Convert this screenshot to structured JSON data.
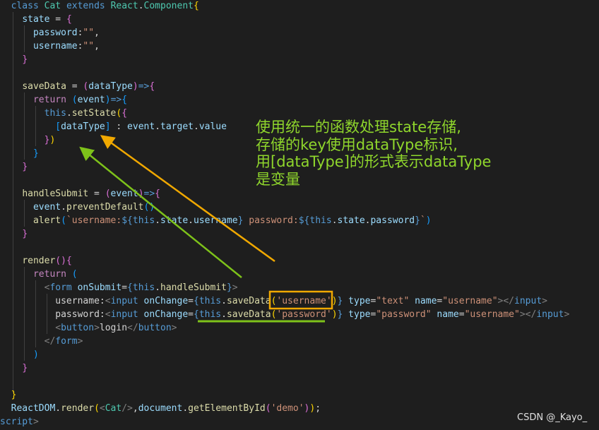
{
  "code_lines": [
    [
      [
        "  ",
        "pl"
      ],
      [
        "class ",
        "kw"
      ],
      [
        "Cat ",
        "cls"
      ],
      [
        "extends ",
        "kw"
      ],
      [
        "React",
        "cls"
      ],
      [
        ".",
        "pl"
      ],
      [
        "Component",
        "cls"
      ],
      [
        "{",
        "br1"
      ]
    ],
    [
      [
        "    ",
        "pl"
      ],
      [
        "state",
        "var"
      ],
      [
        " = ",
        "pl"
      ],
      [
        "{",
        "br2"
      ]
    ],
    [
      [
        "      ",
        "pl"
      ],
      [
        "password",
        "var"
      ],
      [
        ":",
        "pl"
      ],
      [
        "\"\"",
        "str"
      ],
      [
        ",",
        "pl"
      ]
    ],
    [
      [
        "      ",
        "pl"
      ],
      [
        "username",
        "var"
      ],
      [
        ":",
        "pl"
      ],
      [
        "\"\"",
        "str"
      ],
      [
        ",",
        "pl"
      ]
    ],
    [
      [
        "    ",
        "pl"
      ],
      [
        "}",
        "br2"
      ]
    ],
    [
      [
        "",
        "pl"
      ]
    ],
    [
      [
        "    ",
        "pl"
      ],
      [
        "saveData",
        "fn"
      ],
      [
        " = ",
        "pl"
      ],
      [
        "(",
        "br2"
      ],
      [
        "dataType",
        "var"
      ],
      [
        ")",
        "br2"
      ],
      [
        "=>",
        "kw"
      ],
      [
        "{",
        "br2"
      ]
    ],
    [
      [
        "      ",
        "pl"
      ],
      [
        "return ",
        "ctl"
      ],
      [
        "(",
        "br3"
      ],
      [
        "event",
        "var"
      ],
      [
        ")",
        "br3"
      ],
      [
        "=>",
        "kw"
      ],
      [
        "{",
        "br3"
      ]
    ],
    [
      [
        "        ",
        "pl"
      ],
      [
        "this",
        "kw"
      ],
      [
        ".",
        "pl"
      ],
      [
        "setState",
        "fn"
      ],
      [
        "(",
        "br1"
      ],
      [
        "{",
        "br2"
      ]
    ],
    [
      [
        "          ",
        "pl"
      ],
      [
        "[",
        "br3"
      ],
      [
        "dataType",
        "var"
      ],
      [
        "]",
        "br3"
      ],
      [
        " : ",
        "pl"
      ],
      [
        "event",
        "var"
      ],
      [
        ".",
        "pl"
      ],
      [
        "target",
        "var"
      ],
      [
        ".",
        "pl"
      ],
      [
        "value",
        "var"
      ]
    ],
    [
      [
        "        ",
        "pl"
      ],
      [
        "}",
        "br2"
      ],
      [
        ")",
        "br1"
      ]
    ],
    [
      [
        "      ",
        "pl"
      ],
      [
        "}",
        "br3"
      ]
    ],
    [
      [
        "    ",
        "pl"
      ],
      [
        "}",
        "br2"
      ]
    ],
    [
      [
        "",
        "pl"
      ]
    ],
    [
      [
        "    ",
        "pl"
      ],
      [
        "handleSubmit",
        "fn"
      ],
      [
        " = ",
        "pl"
      ],
      [
        "(",
        "br2"
      ],
      [
        "event",
        "var"
      ],
      [
        ")",
        "br2"
      ],
      [
        "=>",
        "kw"
      ],
      [
        "{",
        "br2"
      ]
    ],
    [
      [
        "      ",
        "pl"
      ],
      [
        "event",
        "var"
      ],
      [
        ".",
        "pl"
      ],
      [
        "preventDefault",
        "fn"
      ],
      [
        "()",
        "br3"
      ]
    ],
    [
      [
        "      ",
        "pl"
      ],
      [
        "alert",
        "fn"
      ],
      [
        "(",
        "br3"
      ],
      [
        "`username:",
        "str"
      ],
      [
        "${",
        "kw"
      ],
      [
        "this",
        "kw"
      ],
      [
        ".",
        "pl"
      ],
      [
        "state",
        "var"
      ],
      [
        ".",
        "pl"
      ],
      [
        "username",
        "var"
      ],
      [
        "}",
        "kw"
      ],
      [
        " password:",
        "str"
      ],
      [
        "${",
        "kw"
      ],
      [
        "this",
        "kw"
      ],
      [
        ".",
        "pl"
      ],
      [
        "state",
        "var"
      ],
      [
        ".",
        "pl"
      ],
      [
        "password",
        "var"
      ],
      [
        "}",
        "kw"
      ],
      [
        "`",
        "str"
      ],
      [
        ")",
        "br3"
      ]
    ],
    [
      [
        "    ",
        "pl"
      ],
      [
        "}",
        "br2"
      ]
    ],
    [
      [
        "",
        "pl"
      ]
    ],
    [
      [
        "    ",
        "pl"
      ],
      [
        "render",
        "fn"
      ],
      [
        "(",
        "br2"
      ],
      [
        ")",
        "br2"
      ],
      [
        "{",
        "br2"
      ]
    ],
    [
      [
        "      ",
        "pl"
      ],
      [
        "return ",
        "ctl"
      ],
      [
        "(",
        "br3"
      ]
    ],
    [
      [
        "        ",
        "pl"
      ],
      [
        "<",
        "ang"
      ],
      [
        "form ",
        "tag"
      ],
      [
        "onSubmit",
        "var"
      ],
      [
        "=",
        "pl"
      ],
      [
        "{",
        "kw"
      ],
      [
        "this",
        "kw"
      ],
      [
        ".",
        "pl"
      ],
      [
        "handleSubmit",
        "fn"
      ],
      [
        "}",
        "kw"
      ],
      [
        ">",
        "ang"
      ]
    ],
    [
      [
        "          ",
        "pl"
      ],
      [
        "username:",
        "pl"
      ],
      [
        "<",
        "ang"
      ],
      [
        "input ",
        "tag"
      ],
      [
        "onChange",
        "var"
      ],
      [
        "=",
        "pl"
      ],
      [
        "{",
        "kw"
      ],
      [
        "this",
        "kw"
      ],
      [
        ".",
        "pl"
      ],
      [
        "saveData",
        "fn"
      ],
      [
        "(",
        "br1"
      ],
      [
        "'username'",
        "str"
      ],
      [
        ")",
        "br1"
      ],
      [
        "}",
        "kw"
      ],
      [
        " type",
        "var"
      ],
      [
        "=",
        "pl"
      ],
      [
        "\"text\"",
        "str"
      ],
      [
        " name",
        "var"
      ],
      [
        "=",
        "pl"
      ],
      [
        "\"username\"",
        "str"
      ],
      [
        "></",
        "ang"
      ],
      [
        "input",
        "tag"
      ],
      [
        ">",
        "ang"
      ]
    ],
    [
      [
        "          ",
        "pl"
      ],
      [
        "password:",
        "pl"
      ],
      [
        "<",
        "ang"
      ],
      [
        "input ",
        "tag"
      ],
      [
        "onChange",
        "var"
      ],
      [
        "=",
        "pl"
      ],
      [
        "{",
        "kw"
      ],
      [
        "this",
        "kw"
      ],
      [
        ".",
        "pl"
      ],
      [
        "saveData",
        "fn"
      ],
      [
        "(",
        "br1"
      ],
      [
        "'password'",
        "str"
      ],
      [
        ")",
        "br1"
      ],
      [
        "}",
        "kw"
      ],
      [
        " type",
        "var"
      ],
      [
        "=",
        "pl"
      ],
      [
        "\"password\"",
        "str"
      ],
      [
        " name",
        "var"
      ],
      [
        "=",
        "pl"
      ],
      [
        "\"username\"",
        "str"
      ],
      [
        "></",
        "ang"
      ],
      [
        "input",
        "tag"
      ],
      [
        ">",
        "ang"
      ]
    ],
    [
      [
        "          ",
        "pl"
      ],
      [
        "<",
        "ang"
      ],
      [
        "button",
        "tag"
      ],
      [
        ">",
        "ang"
      ],
      [
        "login",
        "pl"
      ],
      [
        "</",
        "ang"
      ],
      [
        "button",
        "tag"
      ],
      [
        ">",
        "ang"
      ]
    ],
    [
      [
        "        ",
        "pl"
      ],
      [
        "</",
        "ang"
      ],
      [
        "form",
        "tag"
      ],
      [
        ">",
        "ang"
      ]
    ],
    [
      [
        "      ",
        "pl"
      ],
      [
        ")",
        "br3"
      ]
    ],
    [
      [
        "    ",
        "pl"
      ],
      [
        "}",
        "br2"
      ]
    ],
    [
      [
        "",
        "pl"
      ]
    ],
    [
      [
        "  ",
        "pl"
      ],
      [
        "}",
        "br1"
      ]
    ],
    [
      [
        "  ",
        "pl"
      ],
      [
        "ReactDOM",
        "var"
      ],
      [
        ".",
        "pl"
      ],
      [
        "render",
        "fn"
      ],
      [
        "(",
        "br1"
      ],
      [
        "<",
        "ang"
      ],
      [
        "Cat",
        "cls"
      ],
      [
        "/>",
        "ang"
      ],
      [
        ",",
        "pl"
      ],
      [
        "document",
        "var"
      ],
      [
        ".",
        "pl"
      ],
      [
        "getElementById",
        "fn"
      ],
      [
        "(",
        "br2"
      ],
      [
        "'demo'",
        "str"
      ],
      [
        ")",
        "br2"
      ],
      [
        ")",
        "br1"
      ],
      [
        ";",
        "pl"
      ]
    ],
    [
      [
        "",
        "pl"
      ],
      [
        "script",
        "tag"
      ],
      [
        ">",
        "ang"
      ]
    ]
  ],
  "annotation": {
    "lines": [
      "使用统一的函数处理state存储,",
      "存储的key使用dataType标识,",
      "用[dataType]的形式表示dataType",
      "是变量"
    ]
  },
  "watermark": "CSDN @_Kayo_",
  "colors": {
    "background": "#1e1e1e",
    "annotation_text": "#8fd62c",
    "orange_highlight": "#f0a800",
    "green_underline": "#7ec21a"
  }
}
